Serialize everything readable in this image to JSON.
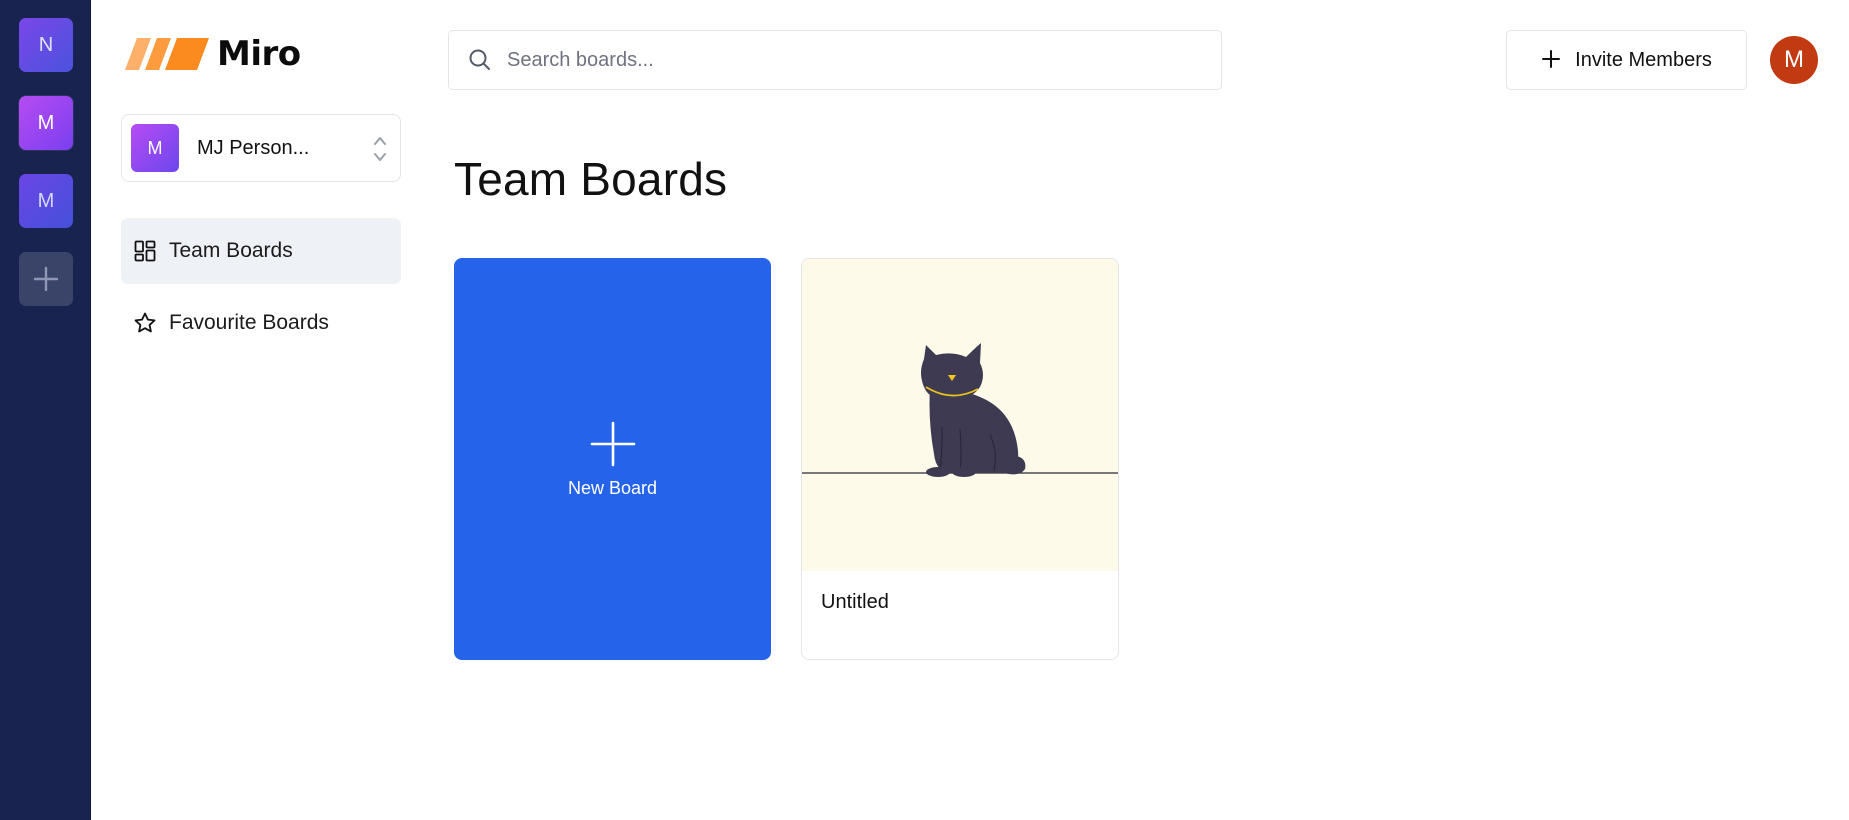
{
  "rail": {
    "orgs": [
      {
        "initial": "N"
      },
      {
        "initial": "M"
      },
      {
        "initial": "M"
      }
    ],
    "add_icon": "plus-icon"
  },
  "brand": {
    "name": "Miro",
    "colors": {
      "logo_light": "#fcb06a",
      "logo_dark": "#fb8b1e"
    }
  },
  "org_switcher": {
    "initial": "M",
    "name": "MJ Person...",
    "icon": "chevron-up-down-icon"
  },
  "nav": {
    "items": [
      {
        "label": "Team Boards",
        "icon": "grid-icon",
        "active": true
      },
      {
        "label": "Favourite Boards",
        "icon": "star-icon",
        "active": false
      }
    ]
  },
  "search": {
    "placeholder": "Search boards...",
    "value": ""
  },
  "header": {
    "invite_label": "Invite Members",
    "user_initial": "M"
  },
  "main": {
    "title": "Team Boards",
    "new_board_label": "New Board",
    "boards": [
      {
        "title": "Untitled"
      }
    ]
  },
  "colors": {
    "rail_bg": "#18234f",
    "accent_blue": "#2563eb",
    "avatar_red": "#c13a11",
    "thumb_bg": "#fdfaea"
  }
}
